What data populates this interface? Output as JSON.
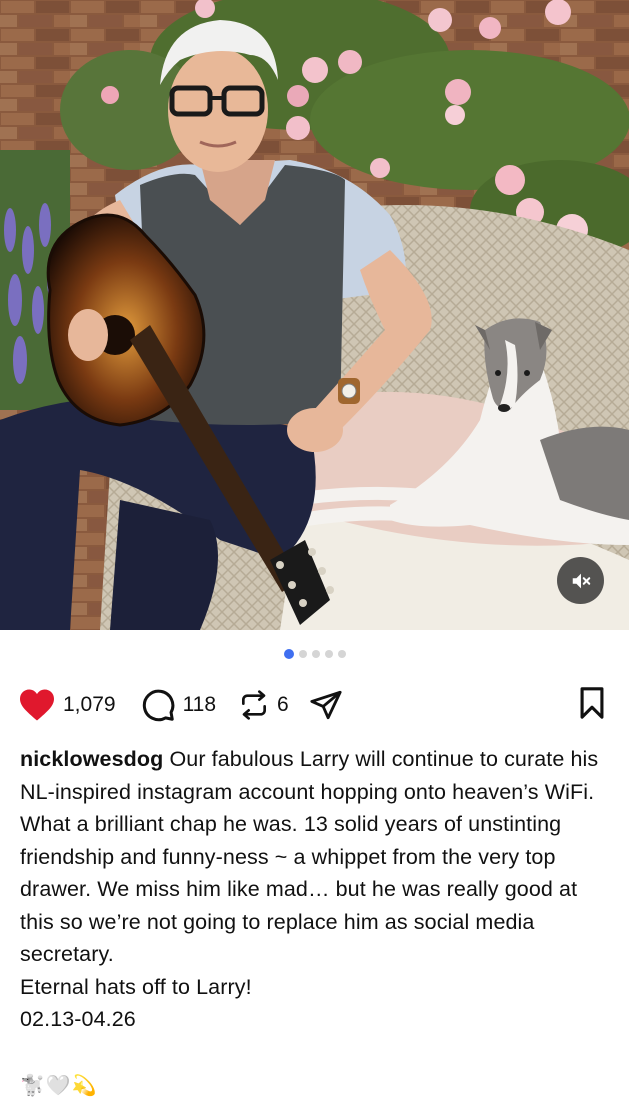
{
  "post": {
    "media": {
      "mute_icon": "speaker-muted-icon",
      "carousel_count": 5,
      "carousel_index": 1
    },
    "actions": {
      "like_count": "1,079",
      "comment_count": "118",
      "repost_count": "6",
      "like_color": "#e0182d"
    },
    "caption": {
      "username": "nicklowesdog",
      "text_lines": [
        " Our fabulous Larry will continue to curate his NL-inspired instagram account hopping onto heaven’s WiFi. What a brilliant chap he was. 13 solid years of unstinting friendship and funny-ness ~ a whippet from the very top drawer. We miss him like mad… but he was really good at this so we’re not going to replace him as social media secretary."
      ],
      "line2": "Eternal hats off to Larry!",
      "line3": "02.13-04.26",
      "emojis": [
        "🐩",
        "🤍",
        "💫"
      ]
    }
  }
}
